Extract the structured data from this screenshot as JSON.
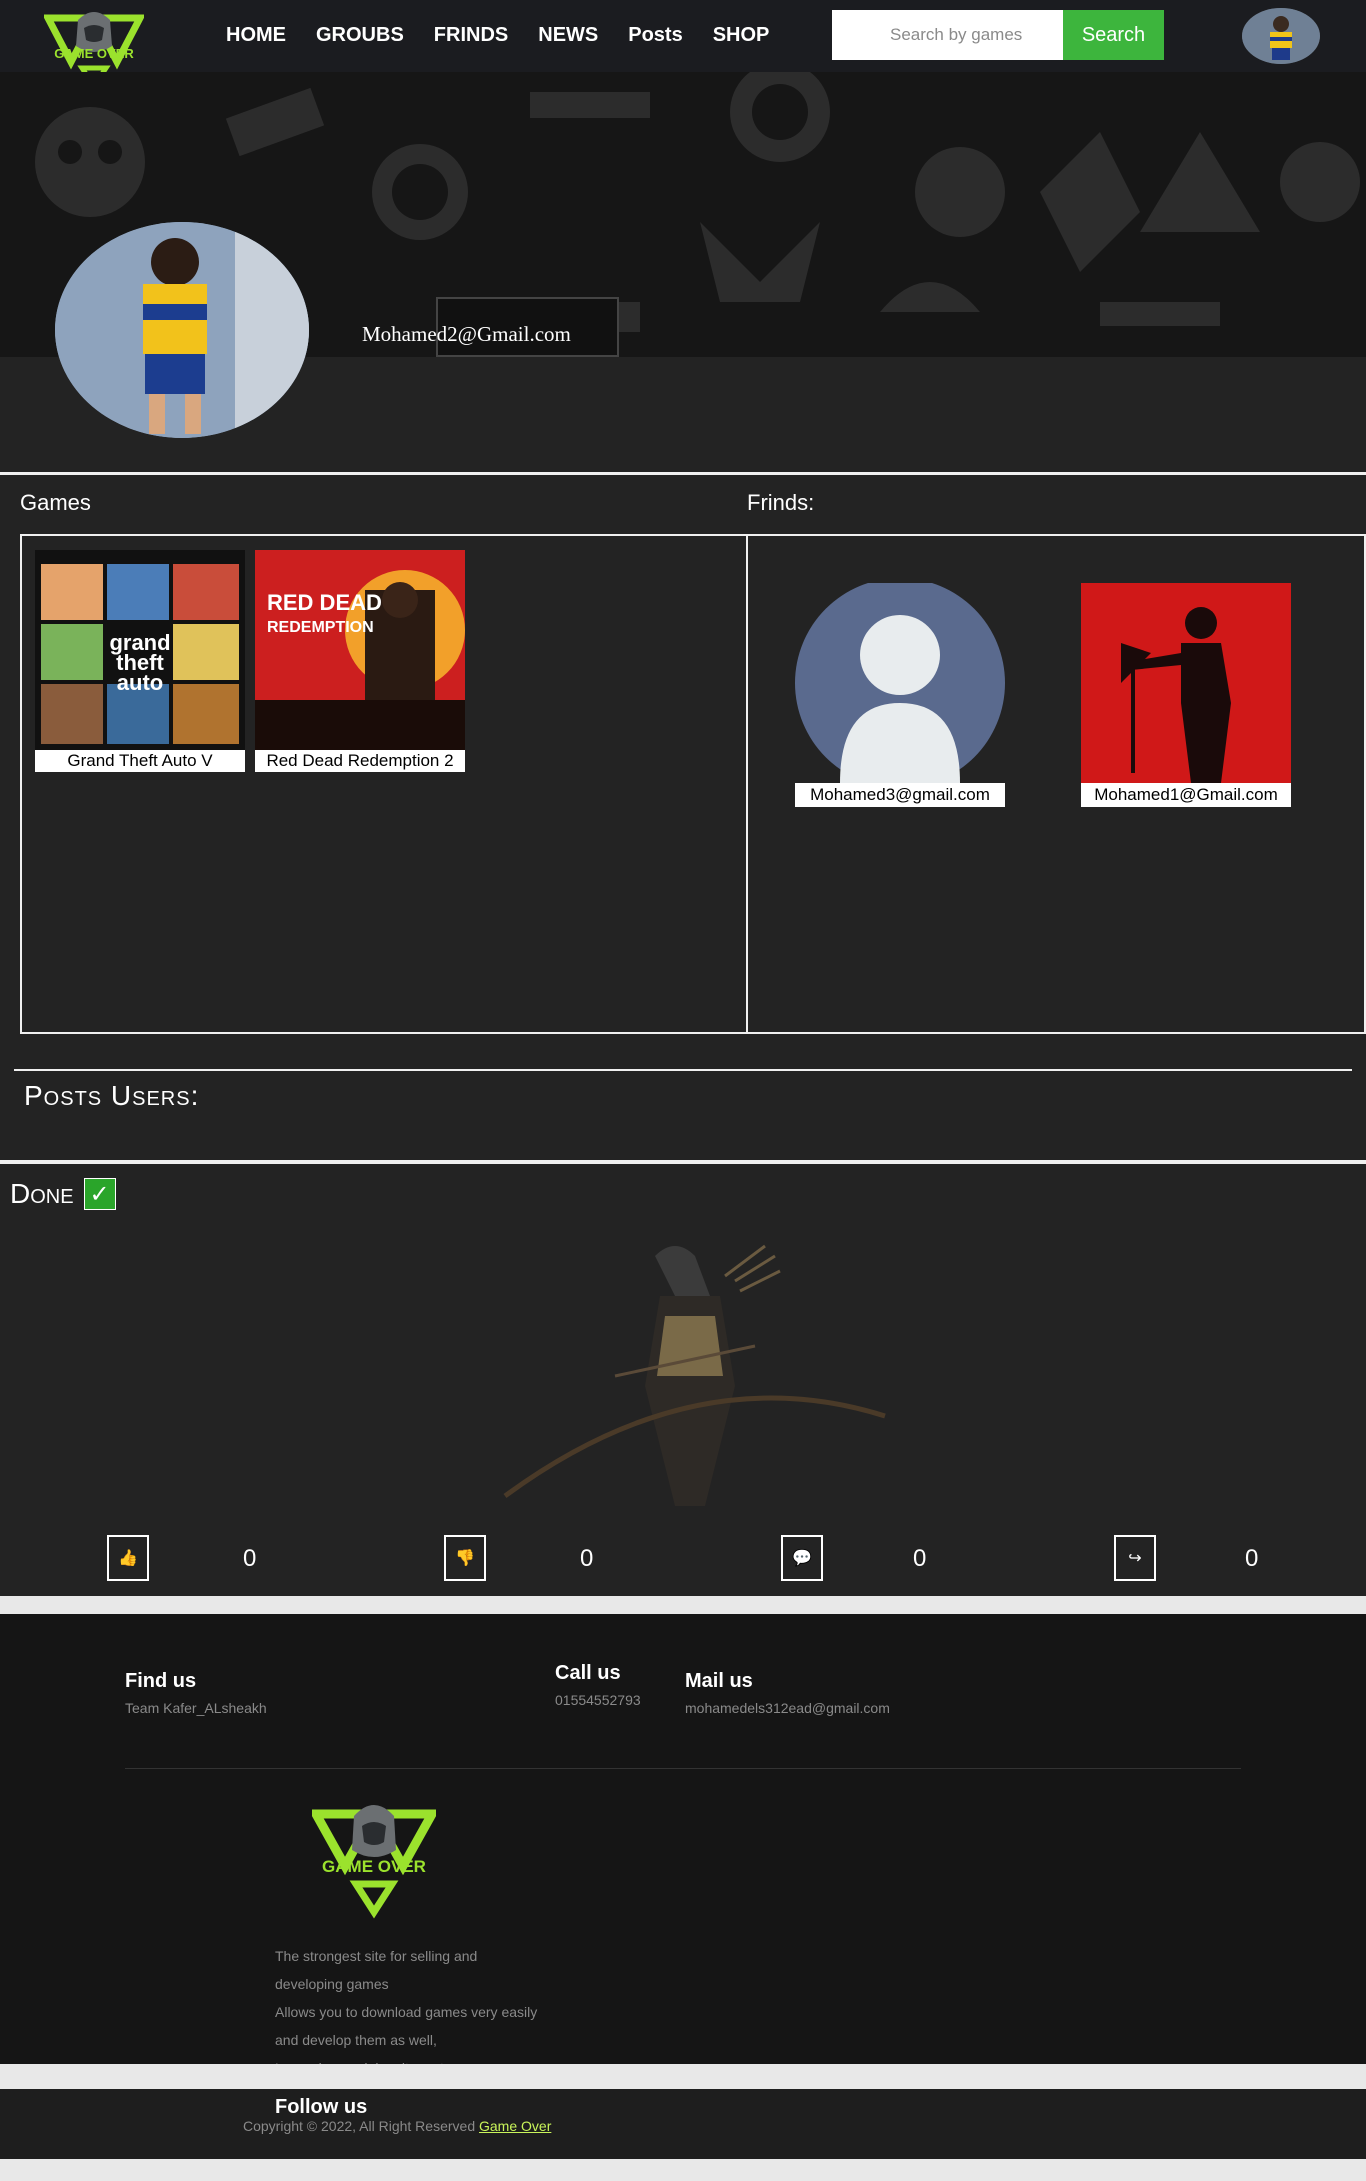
{
  "navbar": {
    "logo_text": "GAME OVER",
    "links": [
      "HOME",
      "GROUBS",
      "FRINDS",
      "NEWS",
      "Posts",
      "SHOP"
    ],
    "search_placeholder": "Search by games",
    "search_button": "Search"
  },
  "profile": {
    "email": "Mohamed2@Gmail.com"
  },
  "games": {
    "title": "Games",
    "items": [
      {
        "name": "Grand Theft Auto V"
      },
      {
        "name": "Red Dead Redemption 2"
      }
    ]
  },
  "friends": {
    "title": "Frinds:",
    "items": [
      {
        "email": "Mohamed3@gmail.com"
      },
      {
        "email": "Mohamed1@Gmail.com"
      }
    ]
  },
  "posts": {
    "section_title": "Posts Users:",
    "post": {
      "title": "Done",
      "check": "✓",
      "likes": "0",
      "dislikes": "0",
      "comments": "0",
      "shares": "0"
    }
  },
  "footer": {
    "find_us": {
      "title": "Find us",
      "text": "Team Kafer_ALsheakh"
    },
    "call_us": {
      "title": "Call us",
      "text": "01554552793"
    },
    "mail_us": {
      "title": "Mail us",
      "text": "mohamedels312ead@gmail.com"
    },
    "logo_text": "GAME OVER",
    "description": [
      "The strongest site for selling and",
      "developing games",
      "Allows you to download games very easily",
      "and develop them as well,",
      "Lorem ipsum dolor sit amet."
    ],
    "follow_us": "Follow us",
    "copyright": "Copyright © 2022, All Right Reserved",
    "copyright_link": "Game Over"
  },
  "colors": {
    "accent_green": "#3db53d",
    "logo_lime": "#9be22d",
    "page_bg": "#232323"
  }
}
